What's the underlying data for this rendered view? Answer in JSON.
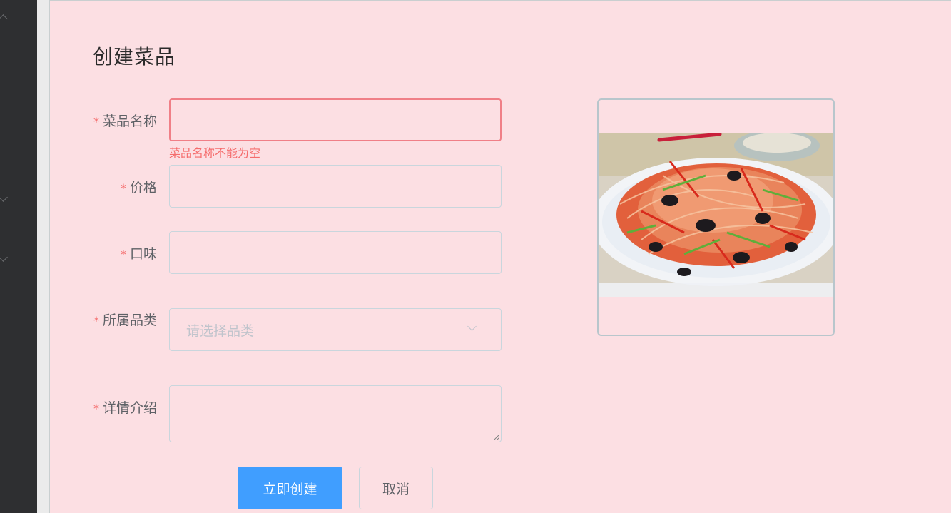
{
  "page": {
    "title": "创建菜品"
  },
  "form": {
    "name": {
      "label": "菜品名称",
      "required_mark": "*",
      "value": "",
      "error": "菜品名称不能为空"
    },
    "price": {
      "label": "价格",
      "required_mark": "*",
      "value": ""
    },
    "taste": {
      "label": "口味",
      "required_mark": "*",
      "value": ""
    },
    "category": {
      "label": "所属品类",
      "required_mark": "*",
      "placeholder": "请选择品类"
    },
    "description": {
      "label": "详情介绍",
      "required_mark": "*",
      "value": ""
    }
  },
  "buttons": {
    "submit": "立即创建",
    "cancel": "取消"
  },
  "colors": {
    "panel_background": "#fcdfe3",
    "primary": "#409eff",
    "error": "#f56c6c"
  }
}
